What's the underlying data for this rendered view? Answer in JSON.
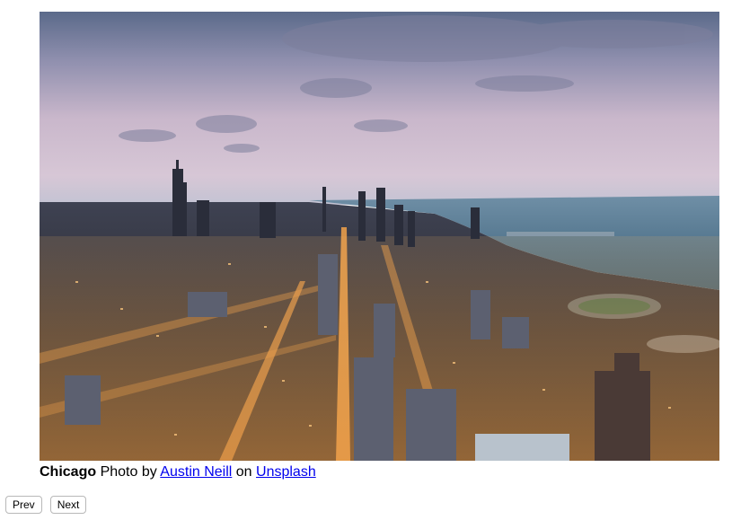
{
  "image": {
    "description": "Aerial view of Chicago skyline at dusk along the lakefront"
  },
  "caption": {
    "city": "Chicago",
    "photo_by": " Photo by ",
    "author": "Austin Neill",
    "on": " on ",
    "source": "Unsplash"
  },
  "controls": {
    "prev_label": "Prev",
    "next_label": "Next"
  }
}
